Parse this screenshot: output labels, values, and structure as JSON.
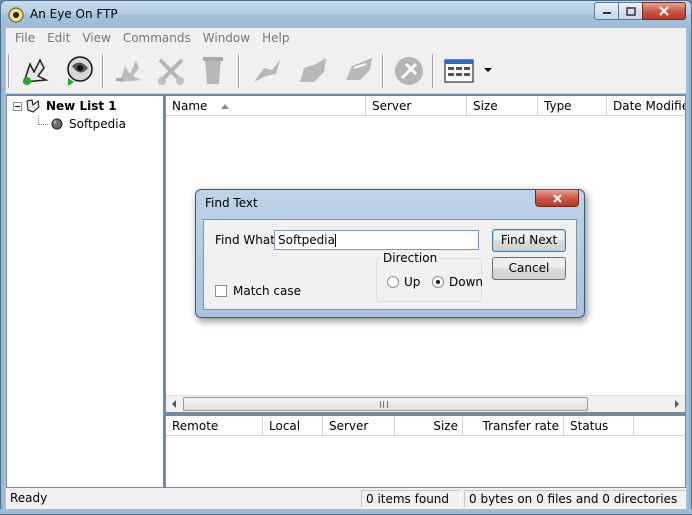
{
  "window": {
    "title": "An Eye On FTP"
  },
  "menu": [
    "File",
    "Edit",
    "View",
    "Commands",
    "Window",
    "Help"
  ],
  "toolbar": {
    "buttons": [
      "connect-wizard-icon",
      "connect-icon",
      "disconnect-icon",
      "cut-icon",
      "delete-icon",
      "upload-icon",
      "download-icon",
      "transfer-icon",
      "stop-icon",
      "view-icon"
    ]
  },
  "tree": {
    "root_label": "New List 1",
    "child_label": "Softpedia"
  },
  "file_list": {
    "columns": [
      "Name",
      "Server",
      "Size",
      "Type",
      "Date Modifie"
    ]
  },
  "transfer_list": {
    "columns": [
      "Remote",
      "Local",
      "Server",
      "Size",
      "Transfer rate",
      "Status"
    ]
  },
  "status": {
    "ready": "Ready",
    "items": "0 items found",
    "summary": "0 bytes on 0 files and 0 directories"
  },
  "dialog": {
    "title": "Find Text",
    "find_label": "Find What:",
    "find_value": "Softpedia",
    "find_next": "Find Next",
    "cancel": "Cancel",
    "match_case": "Match case",
    "direction_label": "Direction",
    "up": "Up",
    "down": "Down"
  },
  "colors": {
    "titlebar": "#b4cde3",
    "close_button": "#c9553f",
    "selection": "#3c7fb1"
  }
}
